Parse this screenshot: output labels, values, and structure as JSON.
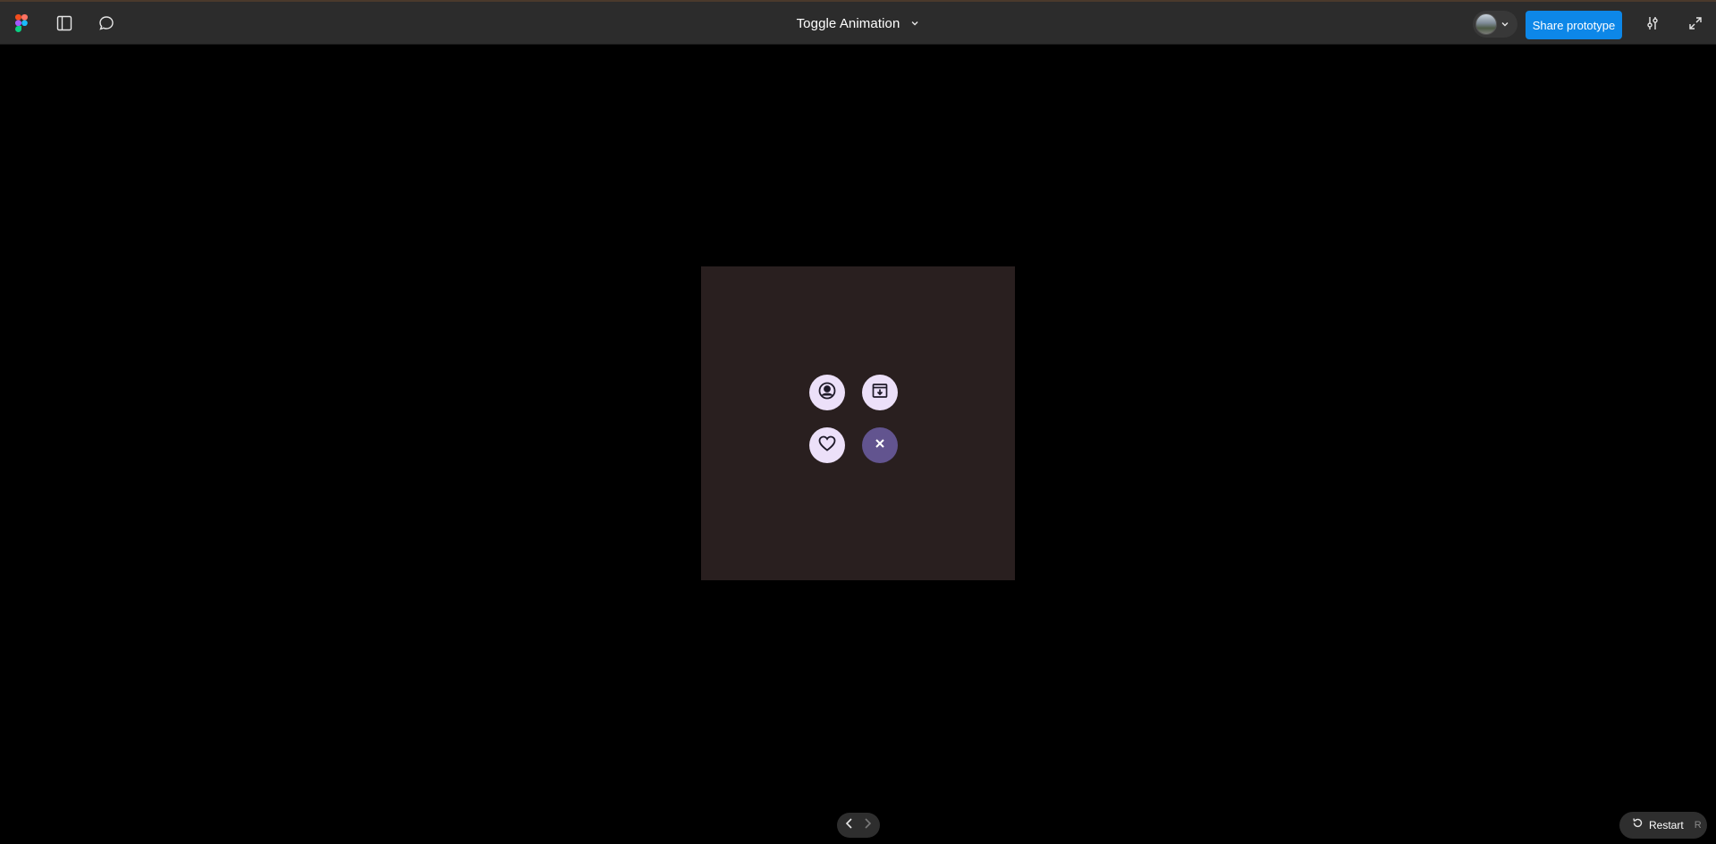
{
  "topbar": {
    "title": "Toggle Animation",
    "share_label": "Share prototype",
    "icons": {
      "logo": "figma-logo-icon",
      "sidebar": "sidebar-panel-icon",
      "comment": "comment-icon",
      "title_dropdown": "chevron-down-icon",
      "avatar_dropdown": "chevron-down-icon",
      "settings": "sliders-icon",
      "fullscreen": "expand-icon"
    }
  },
  "canvas": {
    "frame_background": "#291f1f",
    "buttons": [
      {
        "name": "profile-button",
        "icon": "user-circle-icon"
      },
      {
        "name": "archive-button",
        "icon": "archive-download-icon"
      },
      {
        "name": "favorite-button",
        "icon": "heart-icon"
      },
      {
        "name": "close-toggle-button",
        "icon": "close-icon"
      }
    ],
    "colors": {
      "button_light": "#ece0f9",
      "button_dark": "#62548f",
      "icon_color": "#1e1a29"
    }
  },
  "footer": {
    "restart_label": "Restart",
    "restart_shortcut": "R"
  },
  "colors": {
    "accent": "#0d87e8",
    "topbar": "#2c2c2c",
    "background": "#000000"
  }
}
